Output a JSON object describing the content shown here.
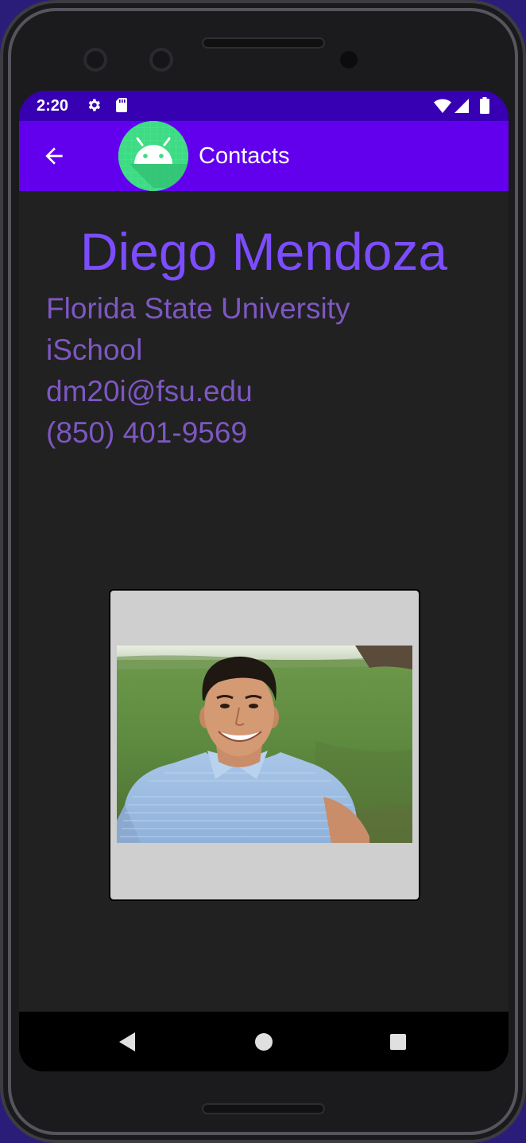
{
  "status_bar": {
    "time": "2:20",
    "icons": [
      "gear-icon",
      "sd-card-icon",
      "wifi-icon",
      "signal-icon",
      "battery-icon"
    ]
  },
  "app_bar": {
    "title": "Contacts",
    "back_icon": "arrow-back-icon",
    "logo_icon": "android-logo-icon",
    "background": "#6200ee"
  },
  "contact": {
    "name": "Diego Mendoza",
    "organization": "Florida State University",
    "department": "iSchool",
    "email": "dm20i@fsu.edu",
    "phone": "(850) 401-9569",
    "photo": "contact-photo"
  },
  "nav_bar": {
    "icons": [
      "nav-back-icon",
      "nav-home-icon",
      "nav-recents-icon"
    ]
  },
  "colors": {
    "status_bar": "#3700b3",
    "app_bar": "#6200ee",
    "name": "#7c4dff",
    "info": "#7e57c2",
    "background": "#212121"
  }
}
